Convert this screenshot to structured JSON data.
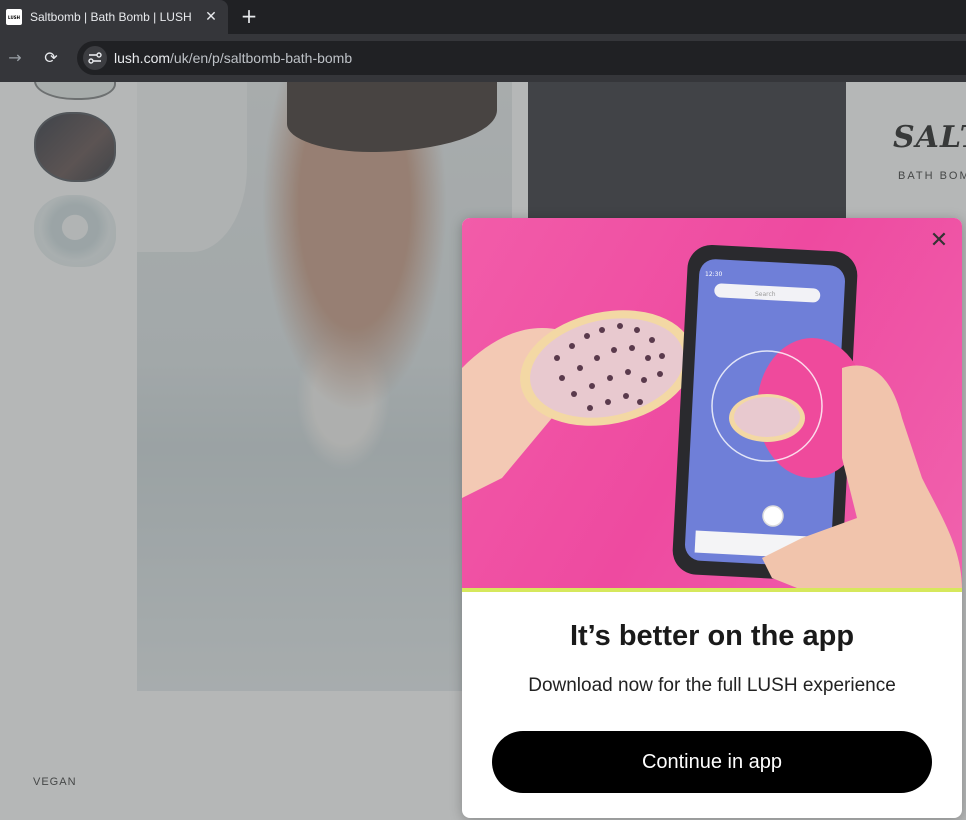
{
  "browser": {
    "tab": {
      "favicon_text": "LUSH",
      "title": "Saltbomb | Bath Bomb | LUSH",
      "close_glyph": "✕"
    },
    "new_tab_glyph": "+",
    "forward_glyph": "→",
    "reload_glyph": "⟳",
    "url_host": "lush.com",
    "url_path": "/uk/en/p/saltbomb-bath-bomb"
  },
  "page": {
    "product_title": "SALTE",
    "product_subtitle": "BATH BOM",
    "vegan_label": "VEGAN"
  },
  "modal": {
    "close_glyph": "✕",
    "title": "It’s better on the app",
    "subtitle": "Download now for the full LUSH experience",
    "cta_label": "Continue in app",
    "phone": {
      "time": "12:30",
      "search_placeholder": "Search"
    }
  },
  "colors": {
    "modal_image_bg": "#ee4aa0",
    "cta_bg": "#000000",
    "overlay": "#5a5f60"
  },
  "icons": [
    "site-info-icon",
    "forward-arrow-icon",
    "reload-icon",
    "close-icon",
    "new-tab-icon"
  ]
}
